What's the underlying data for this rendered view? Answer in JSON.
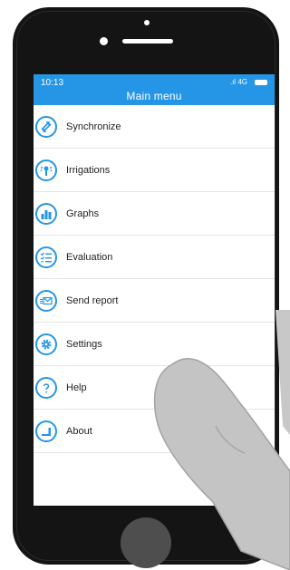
{
  "status_bar": {
    "time": "10:13",
    "signal": "4G"
  },
  "header": {
    "title": "Main menu"
  },
  "menu": {
    "items": [
      {
        "label": "Synchronize",
        "icon": "sync-icon"
      },
      {
        "label": "Irrigations",
        "icon": "sprinkler-icon"
      },
      {
        "label": "Graphs",
        "icon": "bar-chart-icon"
      },
      {
        "label": "Evaluation",
        "icon": "checklist-icon"
      },
      {
        "label": "Send report",
        "icon": "send-report-icon"
      },
      {
        "label": "Settings",
        "icon": "gear-icon"
      },
      {
        "label": "Help",
        "icon": "question-icon"
      },
      {
        "label": "About",
        "icon": "about-icon"
      }
    ]
  },
  "colors": {
    "accent": "#2596e6",
    "phone_body": "#141414",
    "home_button": "#4e4e4e",
    "hand": "#c4c4c4"
  }
}
